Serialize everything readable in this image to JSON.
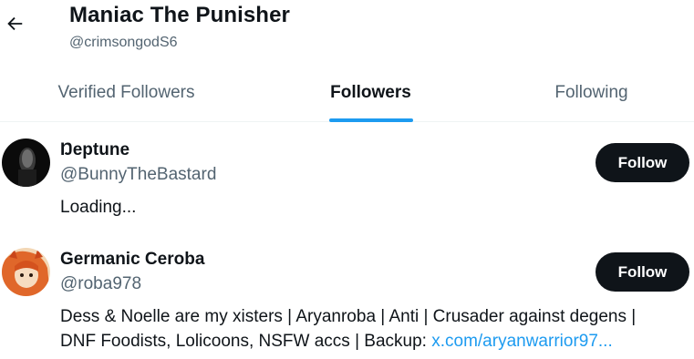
{
  "header": {
    "title": "Maniac The Punisher",
    "handle": "@crimsongodS6",
    "back_icon": "arrow-left-icon"
  },
  "tabs": [
    {
      "label": "Verified Followers",
      "active": false
    },
    {
      "label": "Followers",
      "active": true
    },
    {
      "label": "Following",
      "active": false
    }
  ],
  "accent_color": "#1d9bf0",
  "users": [
    {
      "name": "Ŋeptune",
      "handle": "@BunnyTheBastard",
      "bio_text": "Loading...",
      "follow_label": "Follow"
    },
    {
      "name": "Germanic Ceroba",
      "handle": "@roba978",
      "bio_line1": "Dess & Noelle are my xisters | Aryanroba | Anti | Crusader against degens |",
      "bio_line2_text": "DNF Foodists, Lolicoons, NSFW accs | Backup: ",
      "bio_link": "x.com/aryanwarrior97...",
      "follow_label": "Follow"
    }
  ]
}
